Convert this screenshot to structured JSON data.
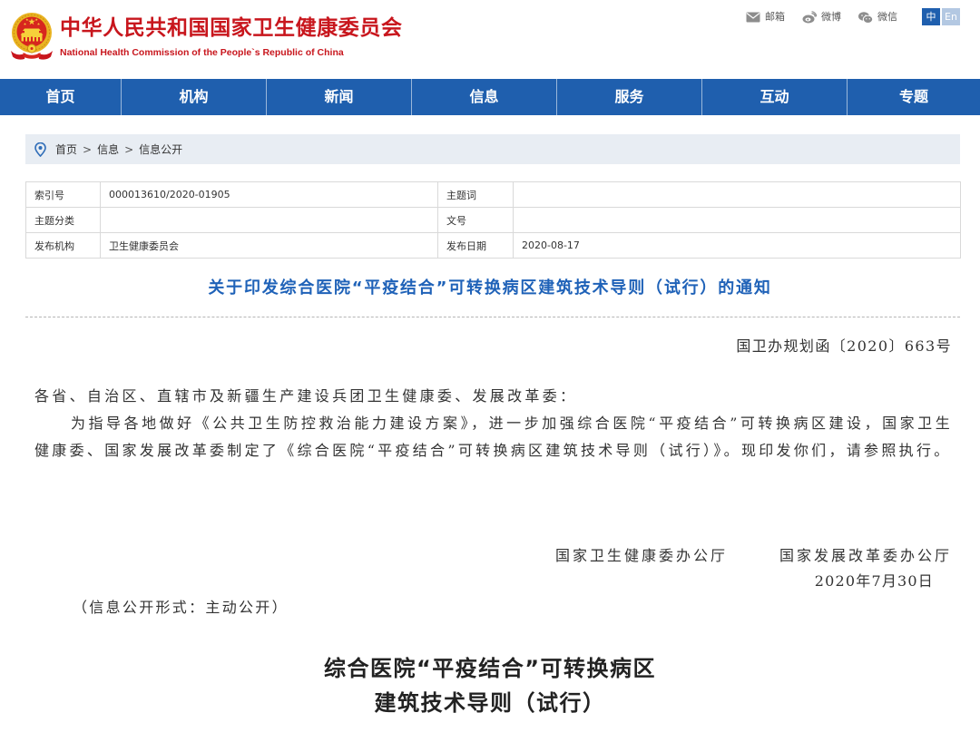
{
  "colors": {
    "brand_red": "#c8161d",
    "nav_blue": "#1f5fae",
    "title_blue": "#1f62b8",
    "breadcrumb_bg": "#e8edf3",
    "lang_active_bg": "#1f5fae",
    "lang_inactive_bg": "#b3c8e2",
    "body_text": "#333333"
  },
  "header": {
    "emblem_icon": "national-emblem-icon",
    "title": "中华人民共和国国家卫生健康委员会",
    "subtitle": "National Health Commission of the People`s Republic of China",
    "links": [
      {
        "label": "邮箱",
        "icon": "mail-icon"
      },
      {
        "label": "微博",
        "icon": "weibo-icon"
      },
      {
        "label": "微信",
        "icon": "wechat-icon"
      }
    ],
    "lang": [
      {
        "label": "中",
        "selected": true
      },
      {
        "label": "En",
        "selected": false
      }
    ]
  },
  "nav": {
    "items": [
      {
        "label": "首页"
      },
      {
        "label": "机构"
      },
      {
        "label": "新闻"
      },
      {
        "label": "信息"
      },
      {
        "label": "服务"
      },
      {
        "label": "互动"
      },
      {
        "label": "专题"
      }
    ]
  },
  "breadcrumb": {
    "icon": "location-pin-icon",
    "separator": ">",
    "items": [
      "首页",
      "信息",
      "信息公开"
    ]
  },
  "meta_table": {
    "rows": [
      {
        "label1": "索引号",
        "value1": "000013610/2020-01905",
        "label2": "主题词",
        "value2": ""
      },
      {
        "label1": "主题分类",
        "value1": "",
        "label2": "文号",
        "value2": ""
      },
      {
        "label1": "发布机构",
        "value1": "卫生健康委员会",
        "label2": "发布日期",
        "value2": "2020-08-17"
      }
    ]
  },
  "article": {
    "title": "关于印发综合医院“平疫结合”可转换病区建筑技术导则（试行）的通知",
    "doc_number": "国卫办规划函〔2020〕663号",
    "salutation": "各省、自治区、直辖市及新疆生产建设兵团卫生健康委、发展改革委：",
    "body": "为指导各地做好《公共卫生防控救治能力建设方案》，进一步加强综合医院“平疫结合”可转换病区建设，国家卫生健康委、国家发展改革委制定了《综合医院“平疫结合”可转换病区建筑技术导则（试行）》。现印发你们，请参照执行。",
    "signatories": [
      "国家卫生健康委办公厅",
      "国家发展改革委办公厅"
    ],
    "date": "2020年7月30日",
    "disclosure": "（信息公开形式：主动公开）"
  },
  "attachment": {
    "title_line1": "综合医院“平疫结合”可转换病区",
    "title_line2": "建筑技术导则（试行）"
  }
}
